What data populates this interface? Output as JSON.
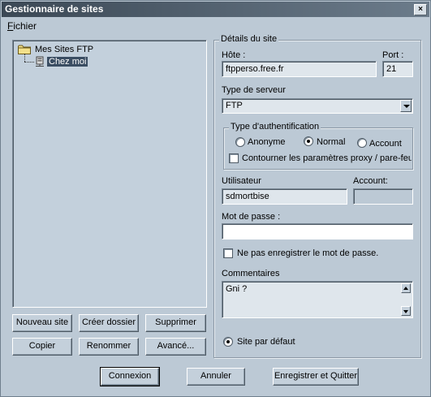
{
  "window": {
    "title": "Gestionnaire de sites",
    "close_label": "×"
  },
  "menu": {
    "fichier_accel": "F",
    "fichier_rest": "ichier"
  },
  "tree": {
    "root_label": "Mes Sites FTP",
    "child_label": "Chez moi"
  },
  "left_buttons": {
    "nouveau_site": "Nouveau site",
    "creer_dossier": "Créer dossier",
    "supprimer": "Supprimer",
    "copier": "Copier",
    "renommer": "Renommer",
    "avance": "Avancé..."
  },
  "details": {
    "legend": "Détails du site",
    "host_label": "Hôte :",
    "host_value": "ftpperso.free.fr",
    "port_label": "Port :",
    "port_value": "21",
    "server_type_label": "Type de serveur",
    "server_type_value": "FTP",
    "auth_legend": "Type d'authentification",
    "auth_anonymous": "Anonyme",
    "auth_normal": "Normal",
    "auth_account": "Account",
    "auth_selected": "Normal",
    "bypass_proxy_label": "Contourner les paramètres proxy / pare-feu",
    "user_label": "Utilisateur",
    "user_value": "sdmortbise",
    "account_label": "Account:",
    "account_value": "",
    "password_label": "Mot de passe :",
    "password_value": "",
    "no_save_password_label": "Ne pas enregistrer le mot de passe.",
    "comments_label": "Commentaires",
    "comments_value": "Gni ?",
    "default_site_label": "Site par défaut"
  },
  "bottom_buttons": {
    "connexion": "Connexion",
    "annuler": "Annuler",
    "enregistrer": "Enregistrer et Quitter"
  },
  "colors": {
    "window_bg": "#bcc9d5",
    "titlebar_start": "#3b4855",
    "titlebar_end": "#6c7c8b",
    "selection": "#3a4d62"
  }
}
